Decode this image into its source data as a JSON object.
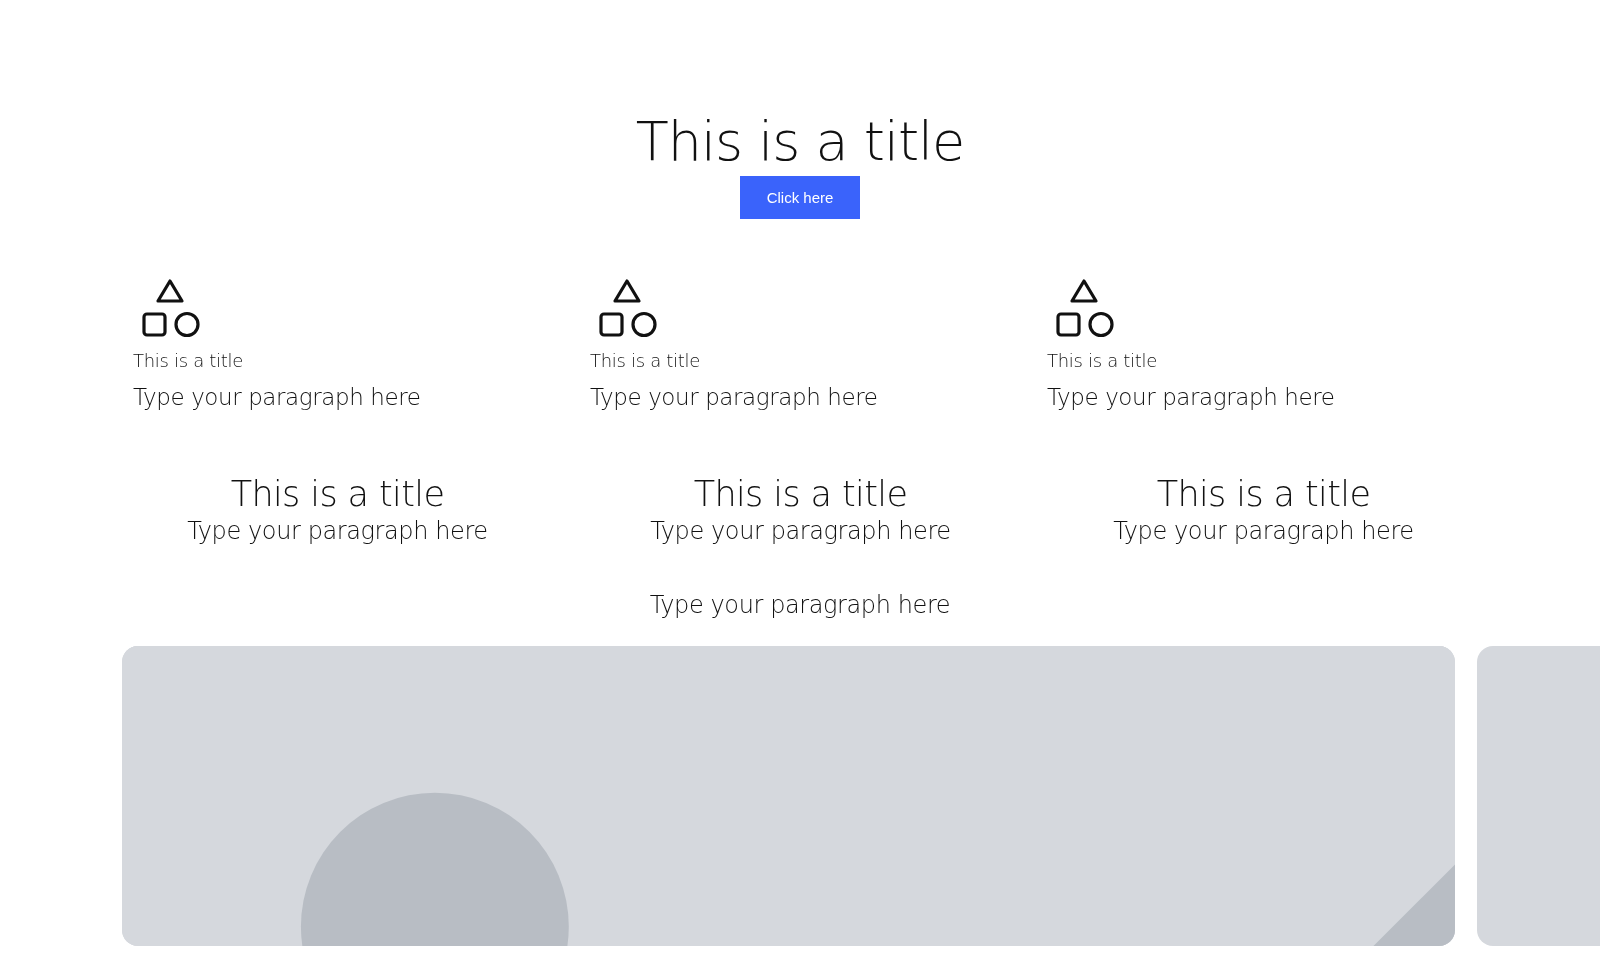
{
  "hero": {
    "title": "This is a title",
    "button": "Click here"
  },
  "features": [
    {
      "title": "This is a title",
      "paragraph": "Type your paragraph here"
    },
    {
      "title": "This is a title",
      "paragraph": "Type your paragraph here"
    },
    {
      "title": "This is a title",
      "paragraph": "Type your paragraph here"
    }
  ],
  "highlights": [
    {
      "title": "This is a title",
      "paragraph": "Type your paragraph here"
    },
    {
      "title": "This is a title",
      "paragraph": "Type your paragraph here"
    },
    {
      "title": "This is a title",
      "paragraph": "Type your paragraph here"
    }
  ],
  "note": "Type your paragraph here",
  "gallery": [
    {
      "kind": "picture"
    },
    {
      "kind": "placeholder"
    }
  ]
}
